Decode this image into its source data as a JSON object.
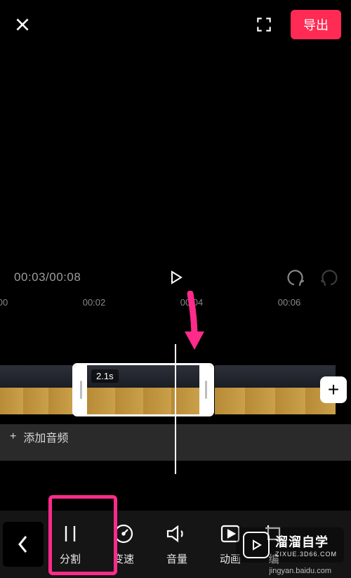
{
  "topbar": {
    "close_icon": "close",
    "fullscreen_icon": "fullscreen",
    "export_label": "导出"
  },
  "controls": {
    "current": "00:03",
    "total": "00:08",
    "play_icon": "play",
    "undo_icon": "undo",
    "redo_icon": "redo"
  },
  "ruler": {
    "ticks": [
      "00",
      "00:02",
      "00:04",
      "00:06"
    ]
  },
  "timeline": {
    "selected_duration": "2.1s",
    "add_clip_icon": "+"
  },
  "audio": {
    "plus": "+",
    "label": "添加音频"
  },
  "toolbar": {
    "back_icon": "chevron-left",
    "tools": [
      {
        "label": "分割",
        "icon": "split"
      },
      {
        "label": "变速",
        "icon": "speedometer"
      },
      {
        "label": "音量",
        "icon": "volume"
      },
      {
        "label": "动画",
        "icon": "play-square"
      },
      {
        "label": "编",
        "icon": "crop"
      }
    ]
  },
  "watermark": {
    "brand": "溜溜自学",
    "sub": "ZIXUE.3D66.COM",
    "credit": "jingyan.baidu.com"
  },
  "colors": {
    "accent": "#ff2b54",
    "highlight": "#ff2b8a"
  }
}
